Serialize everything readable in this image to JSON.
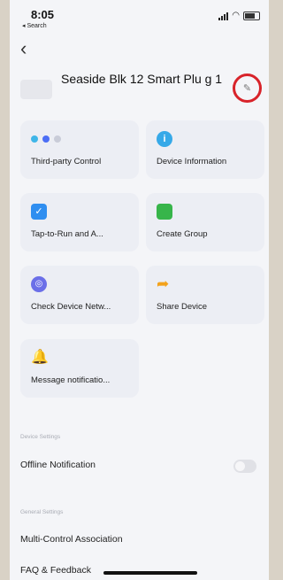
{
  "status_bar": {
    "time": "8:05",
    "back_label": "◂ Search"
  },
  "header": {
    "device_name": "Seaside Blk 12 Smart Plu g 1"
  },
  "tiles": [
    {
      "label": "Third-party Control",
      "icon": "third-party-icons"
    },
    {
      "label": "Device Information",
      "icon": "info-icon"
    },
    {
      "label": "Tap-to-Run and A...",
      "icon": "tap-to-run-icon"
    },
    {
      "label": "Create Group",
      "icon": "group-icon"
    },
    {
      "label": "Check Device Netw...",
      "icon": "network-icon"
    },
    {
      "label": "Share Device",
      "icon": "share-icon"
    },
    {
      "label": "Message notificatio...",
      "icon": "bell-icon"
    }
  ],
  "sections": {
    "device_settings_label": "Device Settings",
    "general_settings_label": "General Settings"
  },
  "rows": {
    "offline_notification": "Offline Notification",
    "multi_control": "Multi-Control Association",
    "faq": "FAQ & Feedback"
  },
  "colors": {
    "highlight_circle": "#d8232a",
    "accent_blue": "#2f8ef0"
  }
}
